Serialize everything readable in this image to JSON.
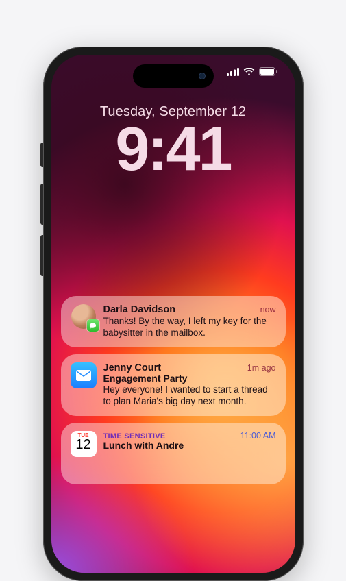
{
  "status": {
    "time_indicator": "9:41",
    "date": "Tuesday, September 12"
  },
  "notifications": [
    {
      "app": "messages",
      "title": "Darla Davidson",
      "subtitle": "",
      "body": "Thanks! By the way, I left my key for the babysitter in the mailbox.",
      "time": "now"
    },
    {
      "app": "mail",
      "title": "Jenny Court",
      "subtitle": "Engagement Party",
      "body": "Hey everyone! I wanted to start a thread to plan Maria's big day next month.",
      "time": "1m ago"
    },
    {
      "app": "calendar",
      "tag": "TIME SENSITIVE",
      "title": "Lunch with Andre",
      "subtitle": "",
      "body": "",
      "time": "11:00 AM",
      "cal_weekday": "TUE",
      "cal_daynum": "12"
    }
  ]
}
